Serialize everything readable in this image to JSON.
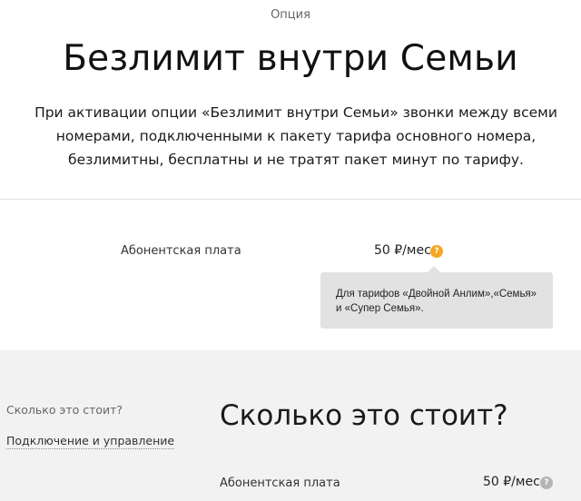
{
  "header": {
    "kicker": "Опция",
    "title": "Безлимит внутри Семьи",
    "description": "При активации опции «Безлимит внутри Семьи» звонки между всеми номерами, подключенными к пакету тарифа основного номера, безлимитны, бесплатны и не тратят пакет минут по тарифу."
  },
  "fee": {
    "label": "Абонентская плата",
    "value": "50 ₽/мес",
    "help_icon": "question-mark-icon",
    "help_color": "#f5a623"
  },
  "tooltip": {
    "text": "Для тарифов «Двойной Анлим»,«Семья» и «Супер Семья»."
  },
  "sidebar": {
    "items": [
      {
        "label": "Сколько это стоит?"
      },
      {
        "label": "Подключение и управление"
      }
    ]
  },
  "section": {
    "title": "Сколько это стоит?",
    "fee_label": "Абонентская плата",
    "fee_value": "50 ₽/мес",
    "help_icon": "question-mark-icon"
  }
}
